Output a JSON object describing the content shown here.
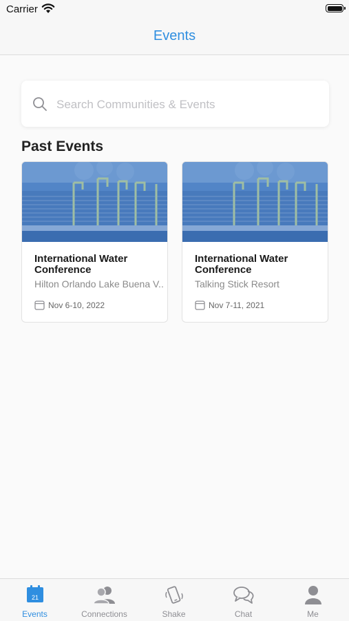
{
  "status_bar": {
    "carrier": "Carrier"
  },
  "nav": {
    "title": "Events"
  },
  "search": {
    "placeholder": "Search Communities & Events",
    "value": ""
  },
  "past_events": {
    "section_title": "Past Events",
    "events": [
      {
        "title": "International Water Conference",
        "venue": "Hilton Orlando Lake Buena V...",
        "date": "Nov 6-10, 2022"
      },
      {
        "title": "International Water Conference",
        "venue": "Talking Stick Resort",
        "date": "Nov 7-11, 2021"
      }
    ]
  },
  "tab_bar": {
    "active": "Events",
    "calendar_icon_day": "21",
    "tabs": [
      {
        "label": "Events",
        "icon": "calendar-icon"
      },
      {
        "label": "Connections",
        "icon": "people-icon"
      },
      {
        "label": "Shake",
        "icon": "phone-shake-icon"
      },
      {
        "label": "Chat",
        "icon": "chat-bubbles-icon"
      },
      {
        "label": "Me",
        "icon": "person-icon"
      }
    ]
  },
  "colors": {
    "accent": "#2f8ee0",
    "tab_inactive": "#8e8e93",
    "card_image_tint": "#4a7fc0"
  }
}
